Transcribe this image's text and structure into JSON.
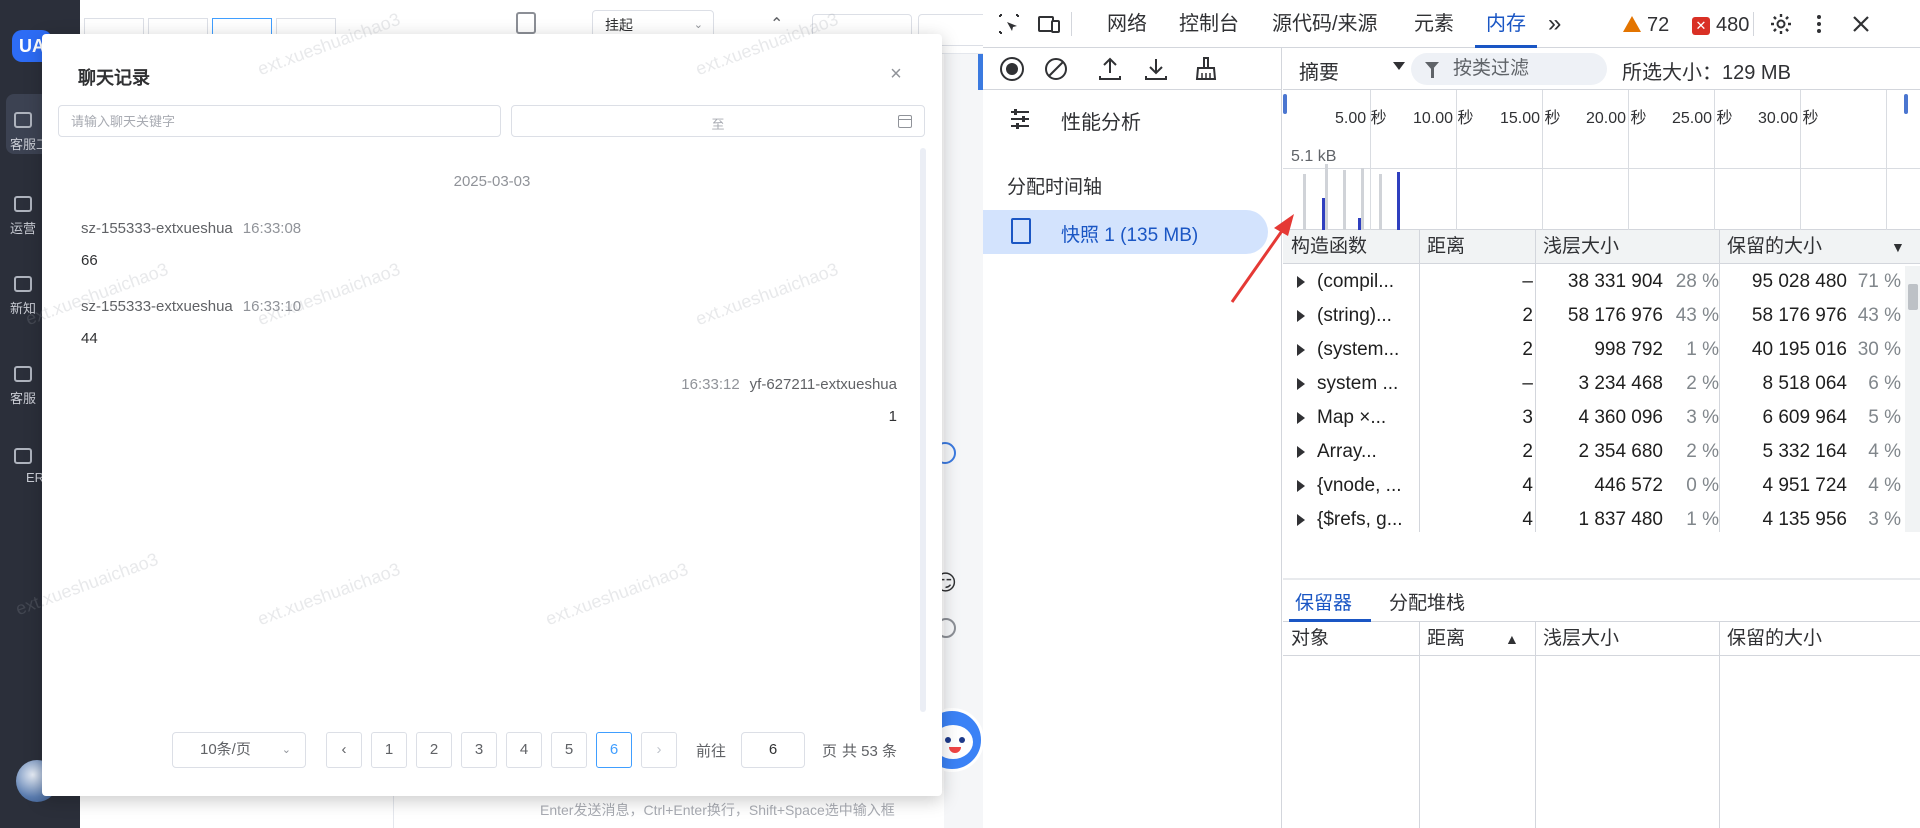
{
  "app": {
    "nav": {
      "logo_text": "UA",
      "items": [
        {
          "label": "客服工",
          "icon": "headset-icon"
        },
        {
          "label": "运营",
          "icon": "chart-icon"
        },
        {
          "label": "新知",
          "icon": "book-icon"
        },
        {
          "label": "客服",
          "icon": "monitor-icon"
        },
        {
          "label": "ER",
          "icon": "desktop-icon"
        }
      ]
    },
    "toolbar": {
      "tabs": [
        "",
        "",
        "",
        ""
      ],
      "hangup_label": "挂起"
    },
    "footer_hint": "Enter发送消息，Ctrl+Enter换行，Shift+Space选中输入框",
    "watermark": "ext.xueshuaichao3"
  },
  "dialog": {
    "title": "聊天记录",
    "search_placeholder": "请输入聊天关键字",
    "date_separator": "至",
    "date_header": "2025-03-03",
    "messages": [
      {
        "sender": "sz-155333-extxueshua",
        "time": "16:33:08",
        "body": "66",
        "side": "left"
      },
      {
        "sender": "sz-155333-extxueshua",
        "time": "16:33:10",
        "body": "44",
        "side": "left"
      },
      {
        "sender": "yf-627211-extxueshua",
        "time": "16:33:12",
        "body": "1",
        "side": "right"
      }
    ],
    "pagination": {
      "page_size": "10条/页",
      "prev": "‹",
      "next": "›",
      "pages": [
        "1",
        "2",
        "3",
        "4",
        "5",
        "6"
      ],
      "current_page": 6,
      "goto_label": "前往",
      "goto_value": "6",
      "page_suffix": "页",
      "total": "共 53 条"
    }
  },
  "devtools": {
    "tabs": [
      "网络",
      "控制台",
      "源代码/来源",
      "元素",
      "内存"
    ],
    "active_tab": "内存",
    "more_tabs": "»",
    "warnings": "72",
    "errors": "480",
    "sidebar": {
      "perf_label": "性能分析",
      "alloc_label": "分配时间轴",
      "snapshot_label": "快照 1 (135 MB)"
    },
    "filterbar": {
      "view": "摘要",
      "class_filter": "按类过滤",
      "selected_size": "所选大小：129 MB"
    },
    "timeline": {
      "labels": [
        "5.00 秒",
        "10.00 秒",
        "15.00 秒",
        "20.00 秒",
        "25.00 秒",
        "30.00 秒"
      ],
      "y_label": "5.1 kB"
    },
    "heap": {
      "headers": [
        "构造函数",
        "距离",
        "浅层大小",
        "保留的大小"
      ],
      "sort_indicator": "▼",
      "rows": [
        {
          "name": "(compil...",
          "distance": "–",
          "shallow": "38 331 904",
          "shallow_pct": "28 %",
          "retained": "95 028 480",
          "retained_pct": "71 %"
        },
        {
          "name": "(string)...",
          "distance": "2",
          "shallow": "58 176 976",
          "shallow_pct": "43 %",
          "retained": "58 176 976",
          "retained_pct": "43 %"
        },
        {
          "name": "(system...",
          "distance": "2",
          "shallow": "998 792",
          "shallow_pct": "1 %",
          "retained": "40 195 016",
          "retained_pct": "30 %"
        },
        {
          "name": "system ...",
          "distance": "–",
          "shallow": "3 234 468",
          "shallow_pct": "2 %",
          "retained": "8 518 064",
          "retained_pct": "6 %"
        },
        {
          "name": "Map   ×...",
          "distance": "3",
          "shallow": "4 360 096",
          "shallow_pct": "3 %",
          "retained": "6 609 964",
          "retained_pct": "5 %"
        },
        {
          "name": "Array...",
          "distance": "2",
          "shallow": "2 354 680",
          "shallow_pct": "2 %",
          "retained": "5 332 164",
          "retained_pct": "4 %"
        },
        {
          "name": "{vnode, ...",
          "distance": "4",
          "shallow": "446 572",
          "shallow_pct": "0 %",
          "retained": "4 951 724",
          "retained_pct": "4 %"
        },
        {
          "name": "{$refs, g...",
          "distance": "4",
          "shallow": "1 837 480",
          "shallow_pct": "1 %",
          "retained": "4 135 956",
          "retained_pct": "3 %"
        }
      ]
    },
    "retainers": {
      "tabs": [
        "保留器",
        "分配堆栈"
      ],
      "headers": [
        "对象",
        "距离",
        "浅层大小",
        "保留的大小"
      ],
      "sort_indicator": "▲"
    },
    "colors": {
      "accent": "#1a56c4",
      "warning": "#e37400",
      "error": "#d93025"
    }
  }
}
